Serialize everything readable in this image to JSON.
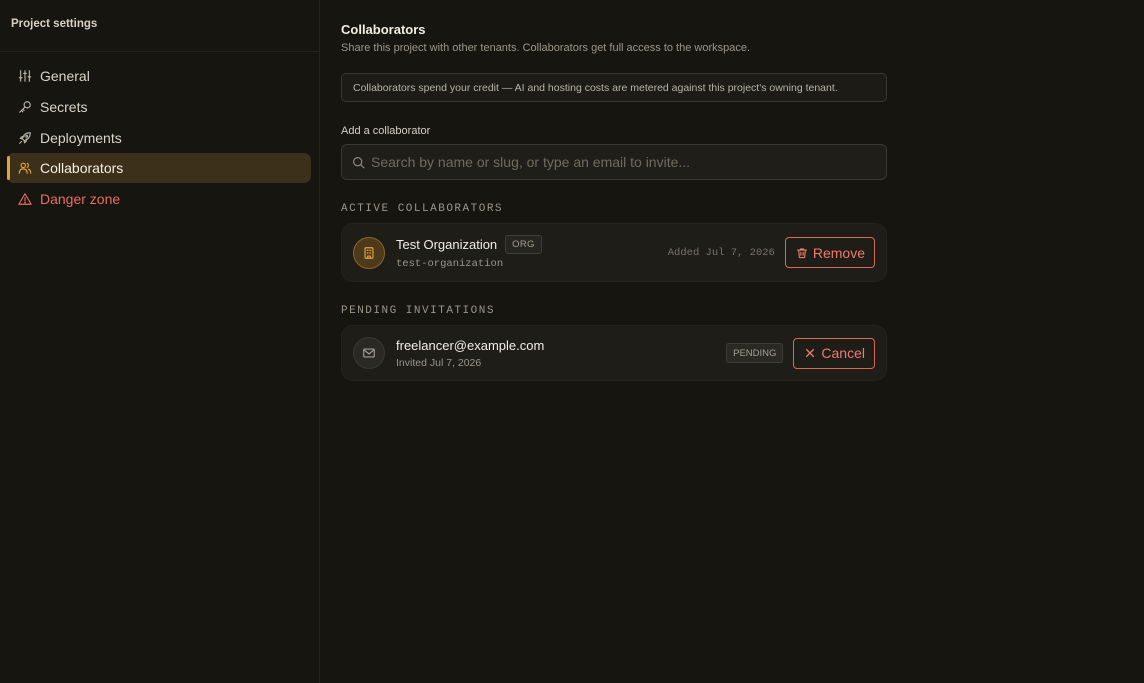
{
  "sidebar": {
    "title": "Project settings",
    "items": [
      {
        "label": "General",
        "icon": "sliders-icon"
      },
      {
        "label": "Secrets",
        "icon": "key-icon"
      },
      {
        "label": "Deployments",
        "icon": "rocket-icon"
      },
      {
        "label": "Collaborators",
        "icon": "users-icon",
        "active": true
      },
      {
        "label": "Danger zone",
        "icon": "warning-icon",
        "danger": true
      }
    ]
  },
  "main": {
    "title": "Collaborators",
    "subtitle": "Share this project with other tenants. Collaborators get full access to the workspace.",
    "notice": "Collaborators spend your credit — AI and hosting costs are metered against this project's owning tenant.",
    "add_label": "Add a collaborator",
    "search_placeholder": "Search by name or slug, or type an email to invite...",
    "active_heading": "ACTIVE COLLABORATORS",
    "collaborator": {
      "name": "Test Organization",
      "badge": "ORG",
      "slug": "test-organization",
      "added": "Added Jul 7, 2026",
      "remove_label": "Remove"
    },
    "pending_heading": "PENDING INVITATIONS",
    "invitation": {
      "email": "freelancer@example.com",
      "invited": "Invited Jul 7, 2026",
      "status": "PENDING",
      "cancel_label": "Cancel"
    }
  },
  "colors": {
    "accent": "#e3a23f",
    "danger": "#e86f61",
    "background": "#161510"
  }
}
